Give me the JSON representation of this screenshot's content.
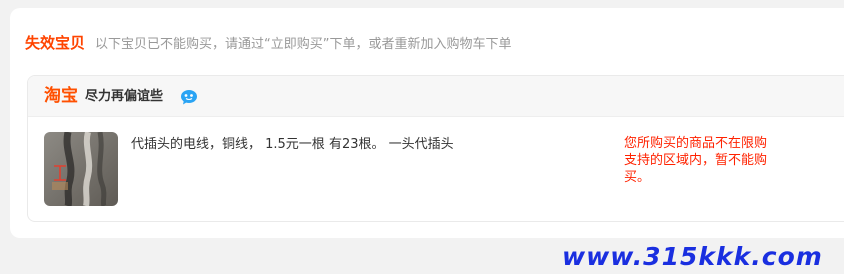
{
  "invalid_section": {
    "title": "失效宝贝",
    "note": "以下宝贝已不能购买，请通过“立即购买”下单，或者重新加入购物车下单"
  },
  "shop": {
    "platform_label": "淘宝",
    "name": "尽力再偏谊些",
    "chat_icon": "wangwang-chat-icon"
  },
  "item": {
    "title": "代插头的电线，铜线， 1.5元一根 有23根。 一头代插头",
    "status": "您所购买的商品不在限购支持的区域内，暂不能购买。"
  },
  "watermark": "www.315kkk.com",
  "colors": {
    "accent": "#ff4400",
    "error": "#ff2200",
    "watermark": "#1a2fe0"
  }
}
